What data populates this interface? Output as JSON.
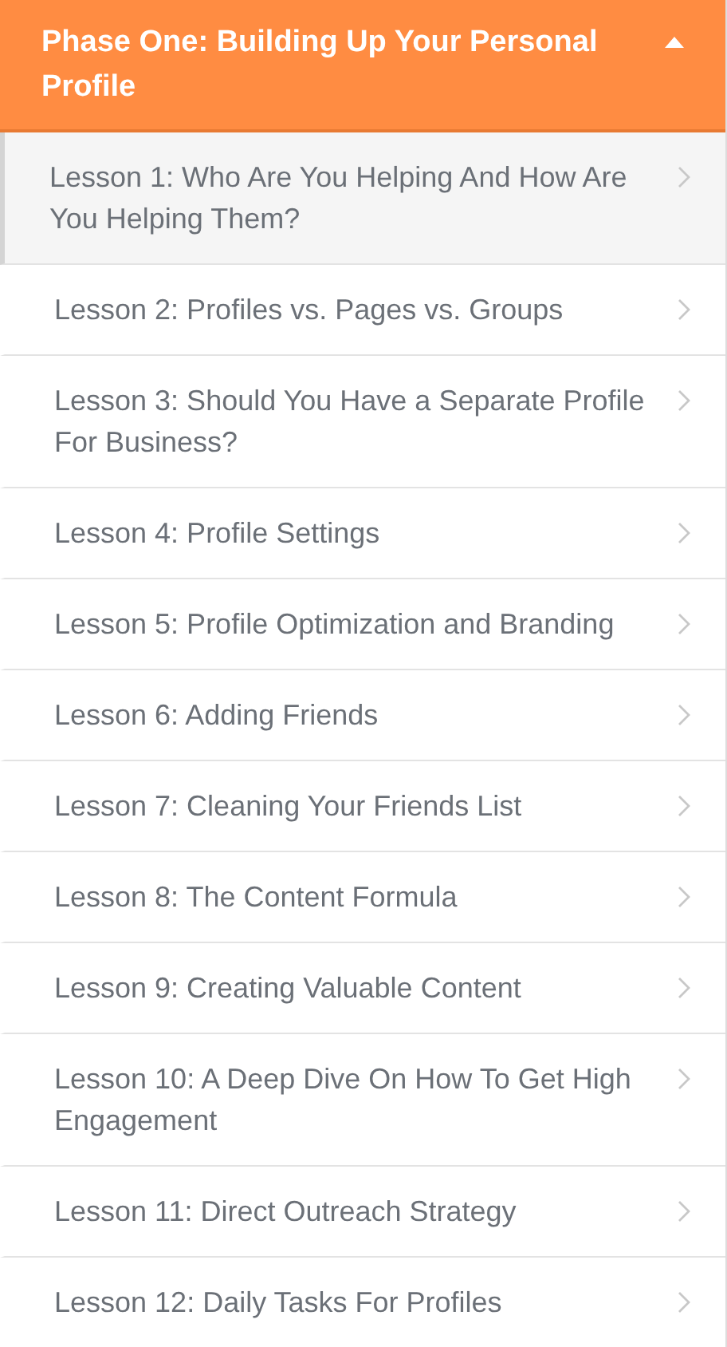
{
  "section": {
    "title": "Phase One: Building Up Your Personal Profile",
    "expanded": true
  },
  "lessons": [
    {
      "title": "Lesson 1: Who Are You Helping And How Are You Helping Them?",
      "selected": true
    },
    {
      "title": "Lesson 2: Profiles vs. Pages vs. Groups",
      "selected": false
    },
    {
      "title": "Lesson 3: Should You Have a Separate Profile For Business?",
      "selected": false
    },
    {
      "title": "Lesson 4: Profile Settings",
      "selected": false
    },
    {
      "title": "Lesson 5: Profile Optimization and Branding",
      "selected": false
    },
    {
      "title": "Lesson 6: Adding Friends",
      "selected": false
    },
    {
      "title": "Lesson 7: Cleaning Your Friends List",
      "selected": false
    },
    {
      "title": "Lesson 8: The Content Formula",
      "selected": false
    },
    {
      "title": "Lesson 9: Creating Valuable Content",
      "selected": false
    },
    {
      "title": "Lesson 10: A Deep Dive On How To Get High Engagement",
      "selected": false
    },
    {
      "title": "Lesson 11: Direct Outreach Strategy",
      "selected": false
    },
    {
      "title": "Lesson 12: Daily Tasks For Profiles",
      "selected": false
    }
  ]
}
